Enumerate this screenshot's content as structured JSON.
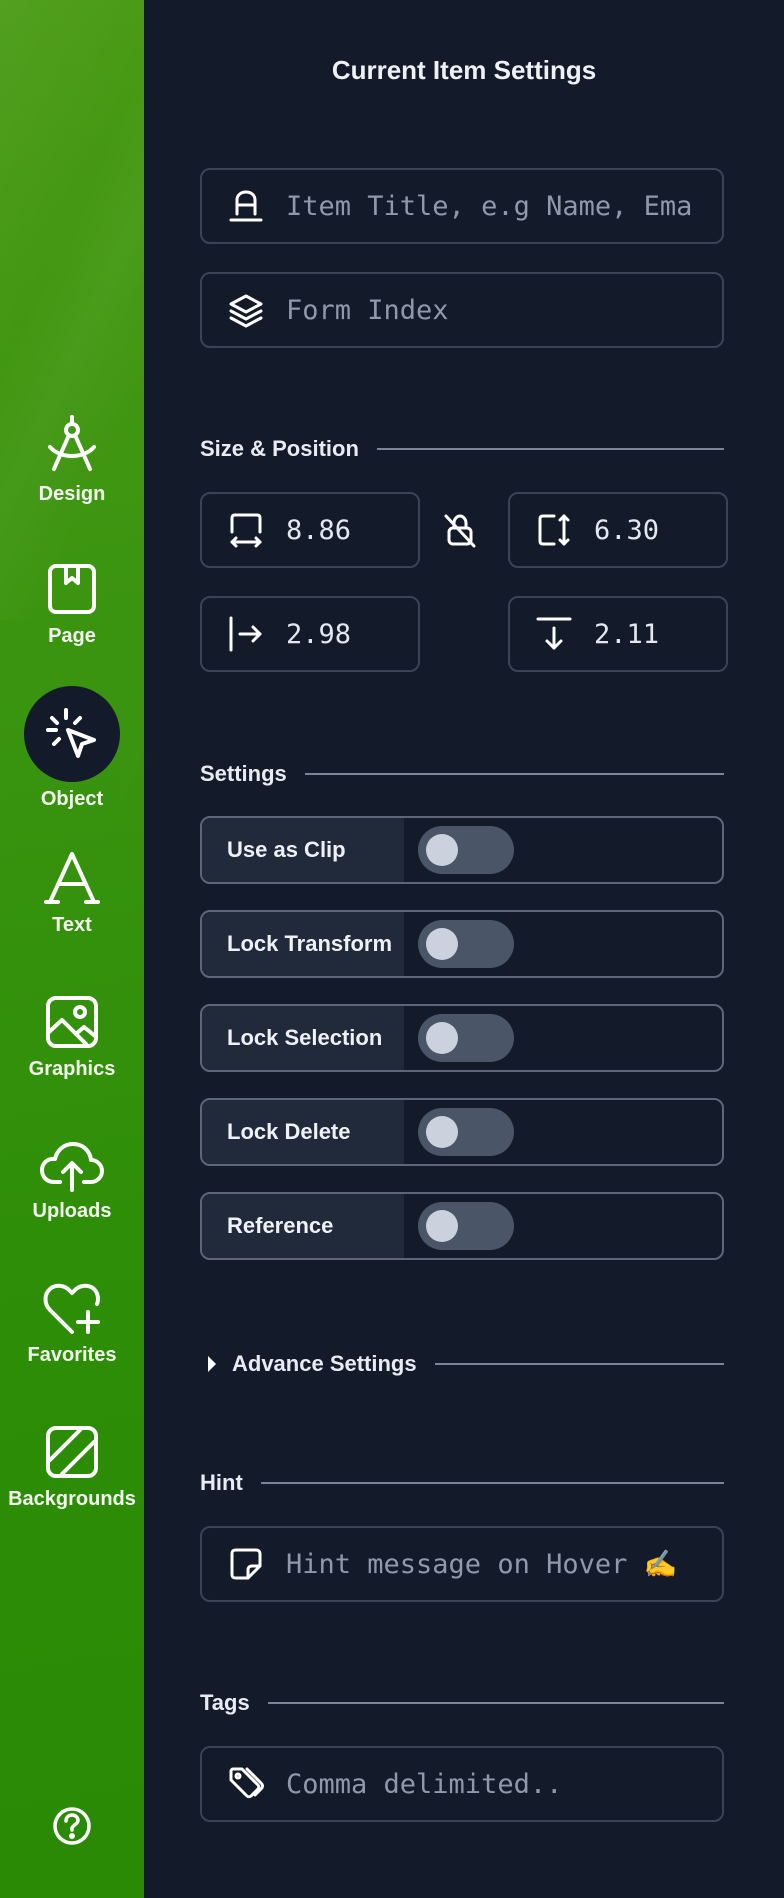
{
  "sidebar": {
    "items": [
      {
        "label": "Design",
        "icon": "compass-icon"
      },
      {
        "label": "Page",
        "icon": "page-icon"
      },
      {
        "label": "Object",
        "icon": "object-cursor-icon",
        "active": true
      },
      {
        "label": "Text",
        "icon": "text-a-icon"
      },
      {
        "label": "Graphics",
        "icon": "image-icon"
      },
      {
        "label": "Uploads",
        "icon": "cloud-upload-icon"
      },
      {
        "label": "Favorites",
        "icon": "heart-plus-icon"
      },
      {
        "label": "Backgrounds",
        "icon": "background-icon"
      }
    ],
    "help_icon": "help-circle-icon",
    "accent": "#2e8d07"
  },
  "panel": {
    "title": "Current Item Settings",
    "item_title_placeholder": "Item Title, e.g Name, Ema",
    "form_index_placeholder": "Form Index",
    "size_position": {
      "title": "Size & Position",
      "width": "8.86",
      "height": "6.30",
      "x": "2.98",
      "y": "2.11"
    },
    "settings": {
      "title": "Settings",
      "toggles": [
        {
          "label": "Use as Clip",
          "on": false
        },
        {
          "label": "Lock Transform",
          "on": false
        },
        {
          "label": "Lock Selection",
          "on": false
        },
        {
          "label": "Lock Delete",
          "on": false
        },
        {
          "label": "Reference",
          "on": false
        }
      ]
    },
    "advance_settings": "Advance Settings",
    "hint": {
      "title": "Hint",
      "placeholder": "Hint message on Hover ✍️"
    },
    "tags": {
      "title": "Tags",
      "placeholder": "Comma delimited.."
    }
  },
  "colors": {
    "background": "#131a29",
    "border": "#3a4458",
    "toggle_bg": "#4a5568"
  }
}
